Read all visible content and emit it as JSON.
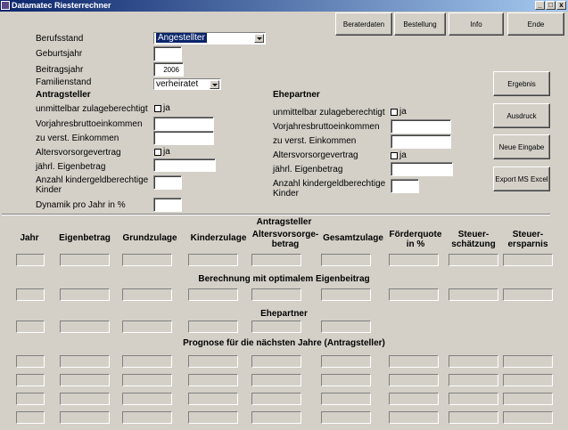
{
  "window": {
    "title": "Datamatec Riesterrechner",
    "minimize": "_",
    "maximize": "□",
    "close": "x"
  },
  "toolbar": {
    "beraterdaten": "Beraterdaten",
    "bestellung": "Bestellung",
    "info": "Info",
    "ende": "Ende"
  },
  "side_buttons": {
    "ergebnis": "Ergebnis",
    "ausdruck": "Ausdruck",
    "neue_eingabe": "Neue Eingabe",
    "export": "Export MS Excel"
  },
  "general": {
    "berufsstand_label": "Berufsstand",
    "berufsstand_value": "Angestellter",
    "geburtsjahr_label": "Geburtsjahr",
    "beitragsjahr_label": "Beitragsjahr",
    "beitragsjahr_value": "2006",
    "familienstand_label": "Familienstand",
    "familienstand_value": "verheiratet"
  },
  "antragsteller": {
    "heading": "Antragsteller",
    "zulage_label": "unmittelbar zulageberechtigt",
    "ja": "ja",
    "vorjahr_label": "Vorjahresbruttoeinkommen",
    "einkommen_label": "zu verst. Einkommen",
    "avv_label": "Altersvorsorgevertrag",
    "eigenbetrag_label": "jährl. Eigenbetrag",
    "kinder_label_1": "Anzahl kindergeldberechtige",
    "kinder_label_2": "Kinder",
    "dynamik_label": "Dynamik pro Jahr in %"
  },
  "ehepartner": {
    "heading": "Ehepartner",
    "zulage_label": "unmittelbar zulageberechtigt",
    "ja": "ja",
    "vorjahr_label": "Vorjahresbruttoeinkommen",
    "einkommen_label": "zu verst. Einkommen",
    "avv_label": "Altersvorsorgevertrag",
    "eigenbetrag_label": "jährl. Eigenbetrag",
    "kinder_label_1": "Anzahl kindergeldberechtige",
    "kinder_label_2": "Kinder"
  },
  "results": {
    "antragsteller_heading": "Antragsteller",
    "columns": [
      {
        "l1": "",
        "l2": "Jahr"
      },
      {
        "l1": "",
        "l2": "Eigenbetrag"
      },
      {
        "l1": "",
        "l2": "Grundzulage"
      },
      {
        "l1": "",
        "l2": "Kinderzulage"
      },
      {
        "l1": "Altersvorsorge-",
        "l2": "betrag"
      },
      {
        "l1": "",
        "l2": "Gesamtzulage"
      },
      {
        "l1": "Förderquote",
        "l2": "in %"
      },
      {
        "l1": "Steuer-",
        "l2": "schätzung"
      },
      {
        "l1": "Steuer-",
        "l2": "ersparnis"
      }
    ],
    "optimal_heading": "Berechnung mit optimalem Eigenbeitrag",
    "ehepartner_heading": "Ehepartner",
    "prognose_heading": "Prognose für die nächsten Jahre (Antragsteller)"
  }
}
